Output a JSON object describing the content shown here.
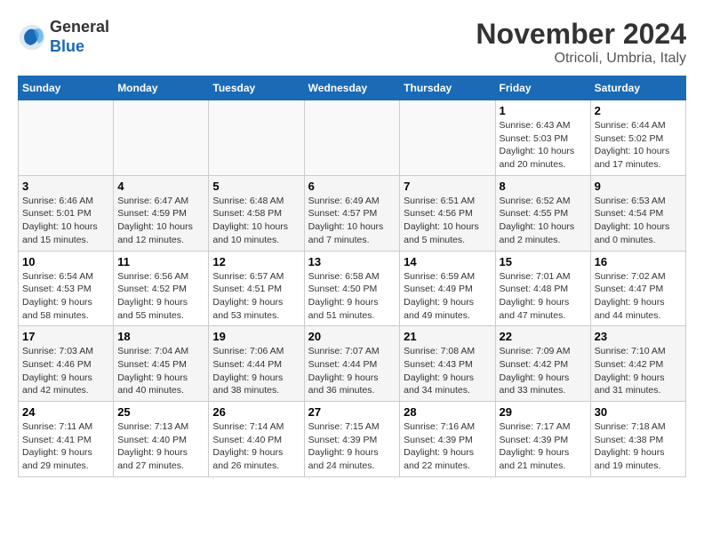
{
  "header": {
    "logo_general": "General",
    "logo_blue": "Blue",
    "month_title": "November 2024",
    "location": "Otricoli, Umbria, Italy"
  },
  "weekdays": [
    "Sunday",
    "Monday",
    "Tuesday",
    "Wednesday",
    "Thursday",
    "Friday",
    "Saturday"
  ],
  "weeks": [
    [
      {
        "day": "",
        "info": ""
      },
      {
        "day": "",
        "info": ""
      },
      {
        "day": "",
        "info": ""
      },
      {
        "day": "",
        "info": ""
      },
      {
        "day": "",
        "info": ""
      },
      {
        "day": "1",
        "info": "Sunrise: 6:43 AM\nSunset: 5:03 PM\nDaylight: 10 hours and 20 minutes."
      },
      {
        "day": "2",
        "info": "Sunrise: 6:44 AM\nSunset: 5:02 PM\nDaylight: 10 hours and 17 minutes."
      }
    ],
    [
      {
        "day": "3",
        "info": "Sunrise: 6:46 AM\nSunset: 5:01 PM\nDaylight: 10 hours and 15 minutes."
      },
      {
        "day": "4",
        "info": "Sunrise: 6:47 AM\nSunset: 4:59 PM\nDaylight: 10 hours and 12 minutes."
      },
      {
        "day": "5",
        "info": "Sunrise: 6:48 AM\nSunset: 4:58 PM\nDaylight: 10 hours and 10 minutes."
      },
      {
        "day": "6",
        "info": "Sunrise: 6:49 AM\nSunset: 4:57 PM\nDaylight: 10 hours and 7 minutes."
      },
      {
        "day": "7",
        "info": "Sunrise: 6:51 AM\nSunset: 4:56 PM\nDaylight: 10 hours and 5 minutes."
      },
      {
        "day": "8",
        "info": "Sunrise: 6:52 AM\nSunset: 4:55 PM\nDaylight: 10 hours and 2 minutes."
      },
      {
        "day": "9",
        "info": "Sunrise: 6:53 AM\nSunset: 4:54 PM\nDaylight: 10 hours and 0 minutes."
      }
    ],
    [
      {
        "day": "10",
        "info": "Sunrise: 6:54 AM\nSunset: 4:53 PM\nDaylight: 9 hours and 58 minutes."
      },
      {
        "day": "11",
        "info": "Sunrise: 6:56 AM\nSunset: 4:52 PM\nDaylight: 9 hours and 55 minutes."
      },
      {
        "day": "12",
        "info": "Sunrise: 6:57 AM\nSunset: 4:51 PM\nDaylight: 9 hours and 53 minutes."
      },
      {
        "day": "13",
        "info": "Sunrise: 6:58 AM\nSunset: 4:50 PM\nDaylight: 9 hours and 51 minutes."
      },
      {
        "day": "14",
        "info": "Sunrise: 6:59 AM\nSunset: 4:49 PM\nDaylight: 9 hours and 49 minutes."
      },
      {
        "day": "15",
        "info": "Sunrise: 7:01 AM\nSunset: 4:48 PM\nDaylight: 9 hours and 47 minutes."
      },
      {
        "day": "16",
        "info": "Sunrise: 7:02 AM\nSunset: 4:47 PM\nDaylight: 9 hours and 44 minutes."
      }
    ],
    [
      {
        "day": "17",
        "info": "Sunrise: 7:03 AM\nSunset: 4:46 PM\nDaylight: 9 hours and 42 minutes."
      },
      {
        "day": "18",
        "info": "Sunrise: 7:04 AM\nSunset: 4:45 PM\nDaylight: 9 hours and 40 minutes."
      },
      {
        "day": "19",
        "info": "Sunrise: 7:06 AM\nSunset: 4:44 PM\nDaylight: 9 hours and 38 minutes."
      },
      {
        "day": "20",
        "info": "Sunrise: 7:07 AM\nSunset: 4:44 PM\nDaylight: 9 hours and 36 minutes."
      },
      {
        "day": "21",
        "info": "Sunrise: 7:08 AM\nSunset: 4:43 PM\nDaylight: 9 hours and 34 minutes."
      },
      {
        "day": "22",
        "info": "Sunrise: 7:09 AM\nSunset: 4:42 PM\nDaylight: 9 hours and 33 minutes."
      },
      {
        "day": "23",
        "info": "Sunrise: 7:10 AM\nSunset: 4:42 PM\nDaylight: 9 hours and 31 minutes."
      }
    ],
    [
      {
        "day": "24",
        "info": "Sunrise: 7:11 AM\nSunset: 4:41 PM\nDaylight: 9 hours and 29 minutes."
      },
      {
        "day": "25",
        "info": "Sunrise: 7:13 AM\nSunset: 4:40 PM\nDaylight: 9 hours and 27 minutes."
      },
      {
        "day": "26",
        "info": "Sunrise: 7:14 AM\nSunset: 4:40 PM\nDaylight: 9 hours and 26 minutes."
      },
      {
        "day": "27",
        "info": "Sunrise: 7:15 AM\nSunset: 4:39 PM\nDaylight: 9 hours and 24 minutes."
      },
      {
        "day": "28",
        "info": "Sunrise: 7:16 AM\nSunset: 4:39 PM\nDaylight: 9 hours and 22 minutes."
      },
      {
        "day": "29",
        "info": "Sunrise: 7:17 AM\nSunset: 4:39 PM\nDaylight: 9 hours and 21 minutes."
      },
      {
        "day": "30",
        "info": "Sunrise: 7:18 AM\nSunset: 4:38 PM\nDaylight: 9 hours and 19 minutes."
      }
    ]
  ]
}
